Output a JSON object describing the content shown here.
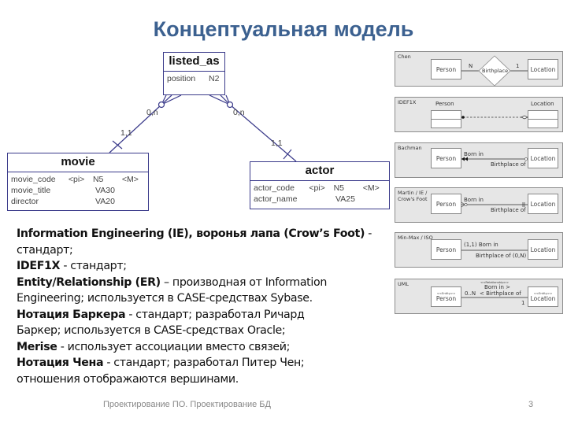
{
  "title": "Концептуальная модель",
  "er_diagram": {
    "entities": {
      "listed_as": {
        "name": "listed_as",
        "attributes": [
          {
            "name": "position",
            "key": "",
            "type": "N2",
            "mandatory": ""
          }
        ]
      },
      "movie": {
        "name": "movie",
        "attributes": [
          {
            "name": "movie_code",
            "key": "<pi>",
            "type": "N5",
            "mandatory": "<M>"
          },
          {
            "name": "movie_title",
            "key": "",
            "type": "VA30",
            "mandatory": ""
          },
          {
            "name": "director",
            "key": "",
            "type": "VA20",
            "mandatory": ""
          }
        ]
      },
      "actor": {
        "name": "actor",
        "attributes": [
          {
            "name": "actor_code",
            "key": "<pi>",
            "type": "N5",
            "mandatory": "<M>"
          },
          {
            "name": "actor_name",
            "key": "",
            "type": "VA25",
            "mandatory": ""
          }
        ]
      }
    },
    "relationships": [
      {
        "from": "movie",
        "to": "listed_as",
        "from_cardinality": "1,1",
        "to_cardinality": "0,n"
      },
      {
        "from": "actor",
        "to": "listed_as",
        "from_cardinality": "1,1",
        "to_cardinality": "0,n"
      }
    ]
  },
  "notations": [
    {
      "name": "Chen",
      "left": "Person",
      "right": "Location",
      "relationship": "Birthplace",
      "left_card": "N",
      "right_card": "1"
    },
    {
      "name": "IDEF1X",
      "left": "Person",
      "right": "Location"
    },
    {
      "name": "Bachman",
      "left": "Person",
      "right": "Location",
      "top_label": "Born in",
      "bottom_label": "Birthplace of"
    },
    {
      "name_lines": [
        "Martin / IE /",
        "Crow's Foot"
      ],
      "left": "Person",
      "right": "Location",
      "top_label": "Born in",
      "bottom_label": "Birthplace of"
    },
    {
      "name": "Min-Max / ISO",
      "left": "Person",
      "right": "Location",
      "top_label": "(1,1) Born in",
      "bottom_label": "Birthplace of (0,N)"
    },
    {
      "name": "UML",
      "left": "Person",
      "right": "Location",
      "stereotype_entity": "<<Entity>>",
      "stereotype_relationship": "<<Relationship>>",
      "top_label": "Born in >",
      "bottom_label": "< Birthplace of",
      "left_card": "0..N",
      "right_card": "1"
    }
  ],
  "body": [
    {
      "bold": "Information Engineering (IE), ",
      "bold2": "воронья лапа",
      "bold3": " (Crow’s Foot)",
      "text": " -"
    },
    {
      "text": "стандарт;"
    },
    {
      "bold": "IDEF1X",
      "text": " - стандарт;"
    },
    {
      "bold": "Entity/Relationship (ER)",
      "text": " – производная от Information"
    },
    {
      "text": "Engineering; используется в CASE-средствах Sybase."
    },
    {
      "bold": "Нотация Баркера",
      "text": " - стандарт; разработал Ричард"
    },
    {
      "text": "Баркер; используется в CASE-средствах Oracle;"
    },
    {
      "bold": "Merise",
      "text": " - использует ассоциации вместо связей;"
    },
    {
      "bold": "Нотация Чена",
      "text": " - стандарт; разработал Питер Чен;"
    },
    {
      "text": "отношения отображаются вершинами."
    }
  ],
  "footer": {
    "text": "Проектирование ПО. Проектирование БД",
    "page": "3"
  },
  "colors": {
    "title": "#3c6190",
    "er_line": "#3a3a8a",
    "panel_bg": "#e6e6e6"
  }
}
